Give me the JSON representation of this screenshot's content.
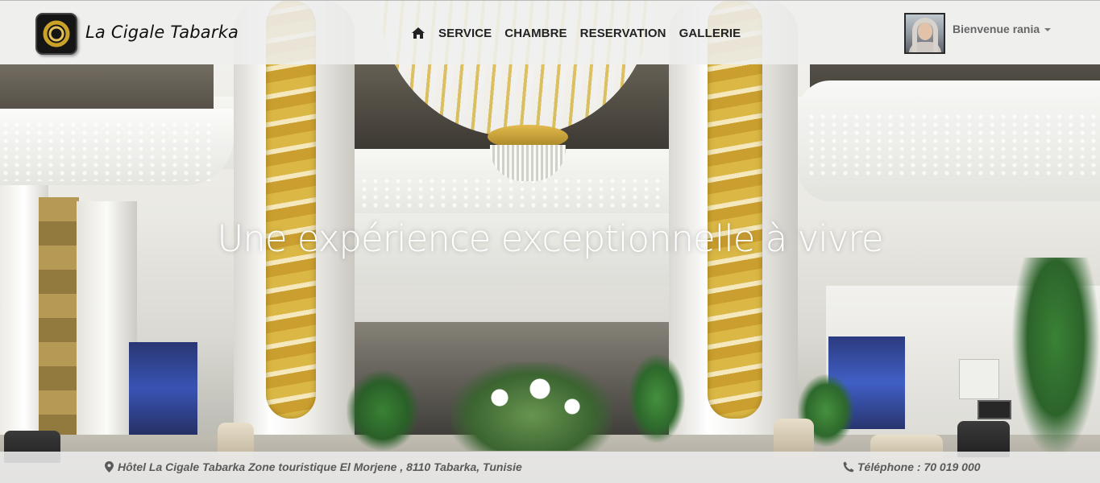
{
  "brand": {
    "name": "La Cigale Tabarka",
    "logo_icon": "gold-swirl-logo",
    "accent_color": "#c9a227"
  },
  "nav": {
    "home_icon": "home-icon",
    "items": [
      "SERVICE",
      "CHAMBRE",
      "RESERVATION",
      "GALLERIE"
    ]
  },
  "user": {
    "greeting": "Bienvenue rania",
    "avatar_icon": "user-avatar"
  },
  "hero": {
    "headline": "Une expérience exceptionnelle à vivre"
  },
  "footer": {
    "address_icon": "map-marker-icon",
    "address": "Hôtel La Cigale Tabarka Zone touristique El Morjene , 8110 Tabarka, Tunisie",
    "phone_icon": "phone-icon",
    "phone": "Téléphone : 70 019 000"
  }
}
